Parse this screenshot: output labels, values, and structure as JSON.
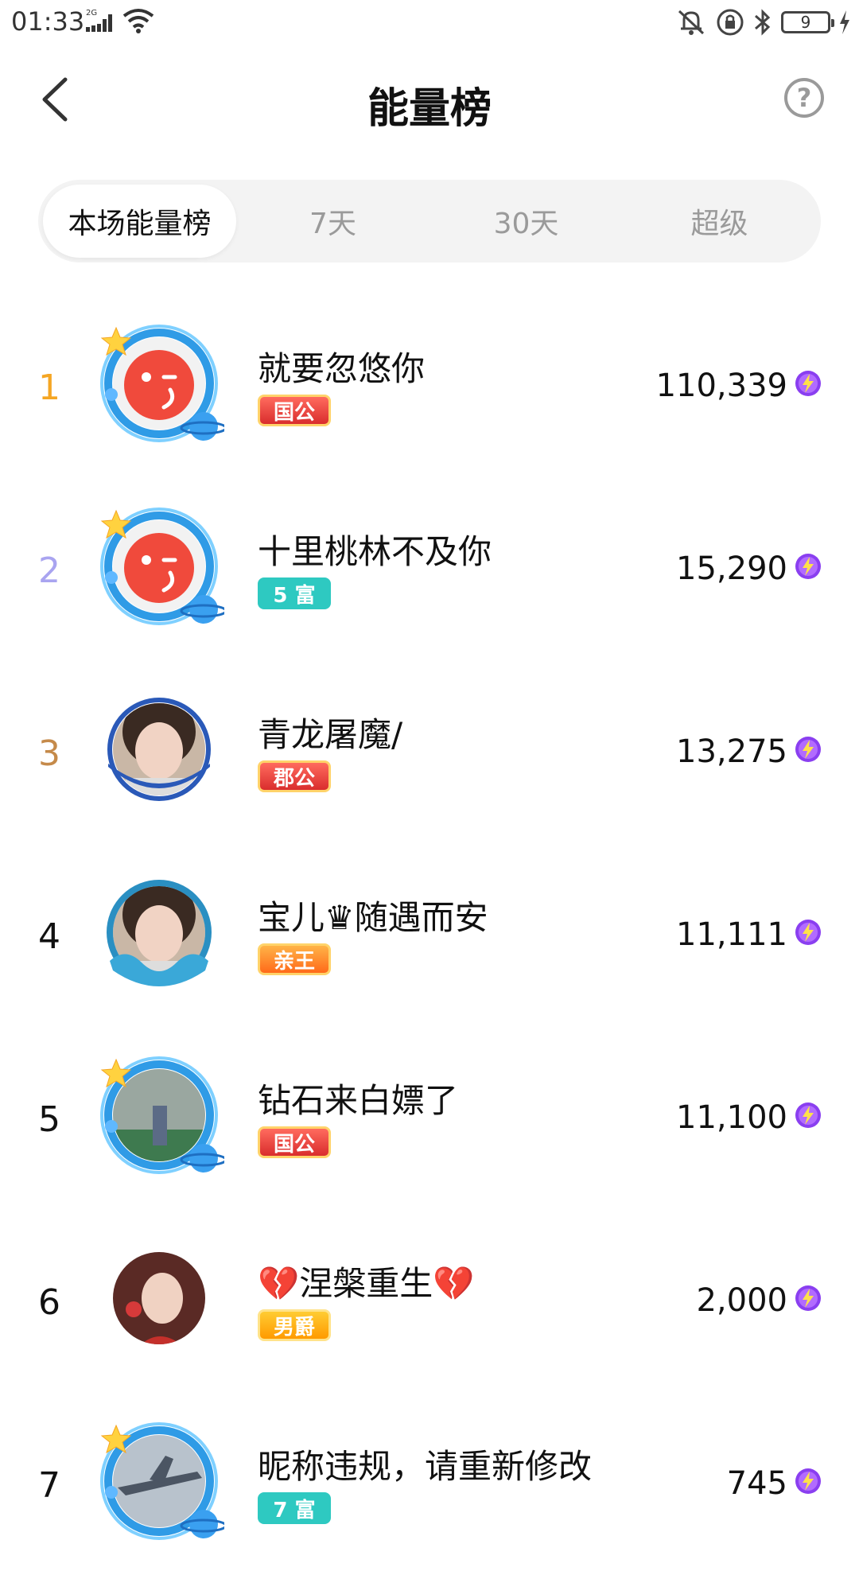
{
  "status_bar": {
    "time": "01:33",
    "network": "2G",
    "battery": "9"
  },
  "header": {
    "title": "能量榜",
    "help_label": "?"
  },
  "tabs": [
    {
      "label": "本场能量榜",
      "active": true
    },
    {
      "label": "7天",
      "active": false
    },
    {
      "label": "30天",
      "active": false
    },
    {
      "label": "超级",
      "active": false
    }
  ],
  "rank_colors": {
    "1": "#f5a623",
    "2": "#a9a4f0",
    "3": "#c58a4a",
    "default": "#111111"
  },
  "users": [
    {
      "rank": "1",
      "name": "就要忽悠你",
      "badge": "国公",
      "badge_style": "red",
      "score": "110,339",
      "avatar": "red-mascot-avatar",
      "frame": "planet-frame"
    },
    {
      "rank": "2",
      "name": "十里桃林不及你",
      "badge": "5 富",
      "badge_style": "teal",
      "score": "15,290",
      "avatar": "red-mascot-avatar",
      "frame": "planet-frame"
    },
    {
      "rank": "3",
      "name": "青龙屠魔/",
      "badge": "郡公",
      "badge_style": "red",
      "score": "13,275",
      "avatar": "woman-photo-avatar",
      "frame": "blue-ring"
    },
    {
      "rank": "4",
      "name": "宝儿♛随遇而安",
      "badge": "亲王",
      "badge_style": "orange",
      "score": "11,111",
      "avatar": "woman-photo-avatar",
      "frame": "wave-frame"
    },
    {
      "rank": "5",
      "name": "钻石来白嫖了",
      "badge": "国公",
      "badge_style": "red",
      "score": "11,100",
      "avatar": "street-photo-avatar",
      "frame": "planet-frame"
    },
    {
      "rank": "6",
      "name": "💔涅槃重生💔",
      "badge": "男爵",
      "badge_style": "gold",
      "score": "2,000",
      "avatar": "costume-photo-avatar",
      "frame": "none"
    },
    {
      "rank": "7",
      "name": "昵称违规，请重新修改",
      "badge": "7 富",
      "badge_style": "teal",
      "score": "745",
      "avatar": "airplane-photo-avatar",
      "frame": "planet-frame"
    }
  ]
}
